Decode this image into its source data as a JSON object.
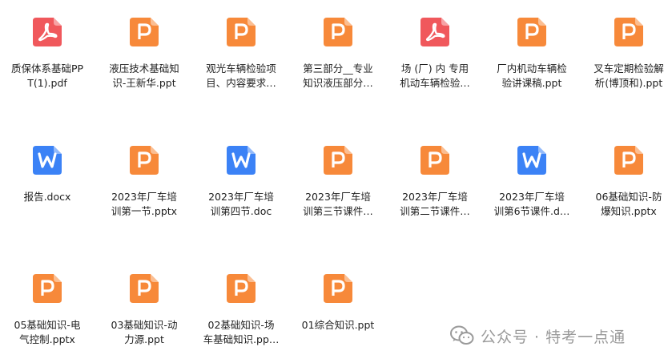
{
  "files": [
    {
      "name_line1": "质保体系基础PP",
      "name_line2": "T(1).pdf",
      "icon": "pdf-icon",
      "type": "pdf"
    },
    {
      "name_line1": "液压技术基础知",
      "name_line2": "识-王新华.ppt",
      "icon": "ppt-icon",
      "type": "ppt"
    },
    {
      "name_line1": "观光车辆检验项",
      "name_line2": "目、内容要求…",
      "icon": "ppt-icon",
      "type": "ppt"
    },
    {
      "name_line1": "第三部分__专业",
      "name_line2": "知识液压部分…",
      "icon": "ppt-icon",
      "type": "ppt"
    },
    {
      "name_line1": "场 (厂) 内 专用",
      "name_line2": "机动车辆检验…",
      "icon": "pdf-icon",
      "type": "pdf"
    },
    {
      "name_line1": "厂内机动车辆检",
      "name_line2": "验讲课稿.ppt",
      "icon": "ppt-icon",
      "type": "ppt"
    },
    {
      "name_line1": "叉车定期检验解",
      "name_line2": "析(博顶和).ppt",
      "icon": "ppt-icon",
      "type": "ppt"
    },
    {
      "name_line1": "报告.docx",
      "name_line2": "",
      "icon": "word-icon",
      "type": "doc"
    },
    {
      "name_line1": "2023年厂车培",
      "name_line2": "训第一节.pptx",
      "icon": "ppt-icon",
      "type": "ppt"
    },
    {
      "name_line1": "2023年厂车培",
      "name_line2": "训第四节.doc",
      "icon": "word-icon",
      "type": "doc"
    },
    {
      "name_line1": "2023年厂车培",
      "name_line2": "训第三节课件…",
      "icon": "ppt-icon",
      "type": "ppt"
    },
    {
      "name_line1": "2023年厂车培",
      "name_line2": "训第二节课件…",
      "icon": "ppt-icon",
      "type": "ppt"
    },
    {
      "name_line1": "2023年厂车培",
      "name_line2": "训第6节课件.d…",
      "icon": "word-icon",
      "type": "doc"
    },
    {
      "name_line1": "06基础知识-防",
      "name_line2": "爆知识.pptx",
      "icon": "ppt-icon",
      "type": "ppt"
    },
    {
      "name_line1": "05基础知识-电",
      "name_line2": "气控制.pptx",
      "icon": "ppt-icon",
      "type": "ppt"
    },
    {
      "name_line1": "03基础知识-动",
      "name_line2": "力源.ppt",
      "icon": "ppt-icon",
      "type": "ppt"
    },
    {
      "name_line1": "02基础知识-场",
      "name_line2": "车基础知识.pp…",
      "icon": "ppt-icon",
      "type": "ppt"
    },
    {
      "name_line1": "01综合知识.ppt",
      "name_line2": "",
      "icon": "ppt-icon",
      "type": "ppt"
    }
  ],
  "watermark": {
    "text": "公众号 · 特考一点通",
    "icon": "wechat-icon"
  },
  "colors": {
    "ppt": "#f7893a",
    "pdf": "#f0585c",
    "doc": "#3b82f6",
    "label": "#1f1f1f",
    "watermark": "#9a9a9a"
  }
}
